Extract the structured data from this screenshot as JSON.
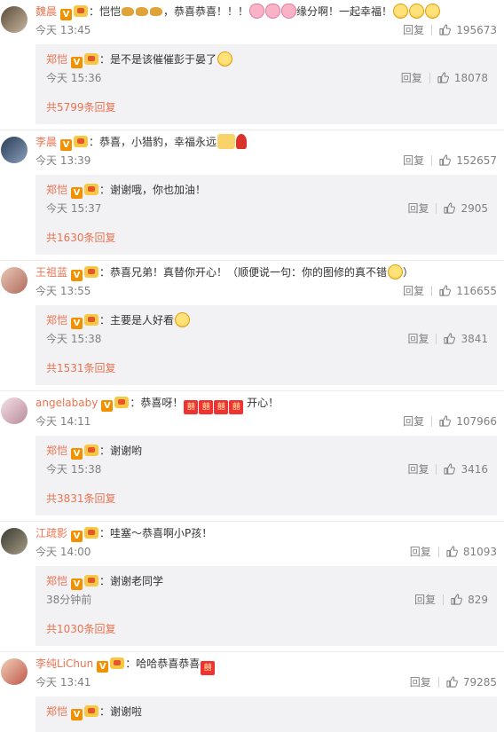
{
  "threads": [
    {
      "user": "魏晨",
      "comment_pre": "：恺恺",
      "comment_mid": "，恭喜恭喜！！！",
      "comment_post": "缘分啊！一起幸福！",
      "time": "今天 13:45",
      "reply_label": "回复",
      "likes": "195673",
      "reply": {
        "user": "郑恺",
        "text": "：是不是该催催彭于晏了",
        "time": "今天 15:36",
        "reply_label": "回复",
        "likes": "18078"
      },
      "more": "共5799条回复"
    },
    {
      "user": "李晨",
      "comment_pre": "：恭喜，小猎豹，幸福永远",
      "time": "今天 13:39",
      "reply_label": "回复",
      "likes": "152657",
      "reply": {
        "user": "郑恺",
        "text": "：谢谢哦，你也加油！",
        "time": "今天 15:37",
        "reply_label": "回复",
        "likes": "2905"
      },
      "more": "共1630条回复"
    },
    {
      "user": "王祖蓝",
      "comment_pre": "：恭喜兄弟！真替你开心！（顺便说一句：你的图修的真不错",
      "comment_post": "）",
      "time": "今天 13:55",
      "reply_label": "回复",
      "likes": "116655",
      "reply": {
        "user": "郑恺",
        "text": "：主要是人好看",
        "time": "今天 15:38",
        "reply_label": "回复",
        "likes": "3841"
      },
      "more": "共1531条回复"
    },
    {
      "user": "angelababy",
      "comment_pre": "：恭喜呀！",
      "comment_post": " 开心！",
      "time": "今天 14:11",
      "reply_label": "回复",
      "likes": "107966",
      "reply": {
        "user": "郑恺",
        "text": "：谢谢哟",
        "time": "今天 15:38",
        "reply_label": "回复",
        "likes": "3416"
      },
      "more": "共3831条回复"
    },
    {
      "user": "江疏影",
      "comment_pre": "：哇塞～恭喜啊小P孩！",
      "time": "今天 14:00",
      "reply_label": "回复",
      "likes": "81093",
      "reply": {
        "user": "郑恺",
        "text": "：谢谢老同学",
        "time": "38分钟前",
        "reply_label": "回复",
        "likes": "829"
      },
      "more": "共1030条回复"
    },
    {
      "user": "李纯LiChun",
      "comment_pre": "：哈哈恭喜恭喜",
      "time": "今天 13:41",
      "reply_label": "回复",
      "likes": "79285",
      "reply": {
        "user": "郑恺",
        "text": "：谢谢啦"
      }
    }
  ],
  "colors": {
    "username": "#eb7350",
    "meta": "#808080",
    "reply_bg": "#f2f2f5",
    "verified": "#f29100"
  },
  "icons": {
    "like": "thumbs-up-icon",
    "verified": "verified-v-icon",
    "member": "member-crown-icon"
  }
}
